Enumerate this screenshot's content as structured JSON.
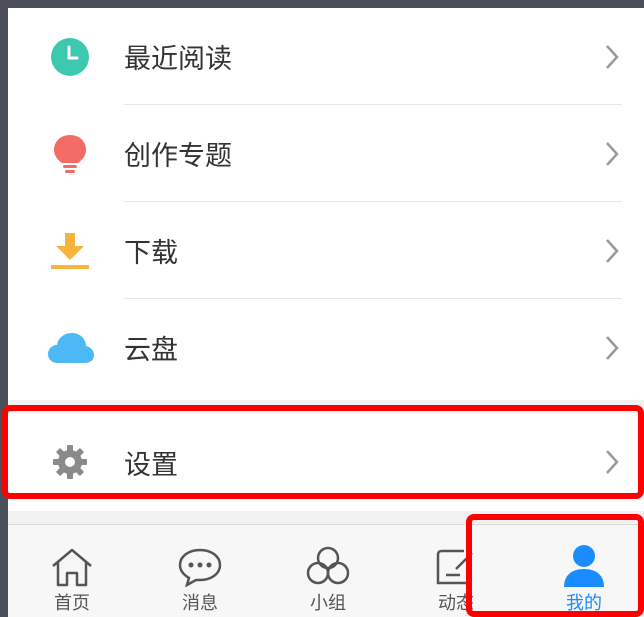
{
  "menu": {
    "items": [
      {
        "label": "最近阅读",
        "icon": "clock-icon",
        "color": "#3cc9b0"
      },
      {
        "label": "创作专题",
        "icon": "lightbulb-icon",
        "color": "#f26b64"
      },
      {
        "label": "下载",
        "icon": "download-icon",
        "color": "#f7b43c"
      },
      {
        "label": "云盘",
        "icon": "cloud-icon",
        "color": "#4cb8f5"
      }
    ],
    "settings": {
      "label": "设置",
      "icon": "gear-icon",
      "color": "#8a8a8a"
    }
  },
  "tabbar": {
    "tabs": [
      {
        "label": "首页",
        "icon": "home-icon"
      },
      {
        "label": "消息",
        "icon": "chat-bubble-icon"
      },
      {
        "label": "小组",
        "icon": "group-circles-icon"
      },
      {
        "label": "动态",
        "icon": "edit-note-icon"
      },
      {
        "label": "我的",
        "icon": "person-icon",
        "active": true
      }
    ],
    "active_color": "#1a8cff"
  }
}
